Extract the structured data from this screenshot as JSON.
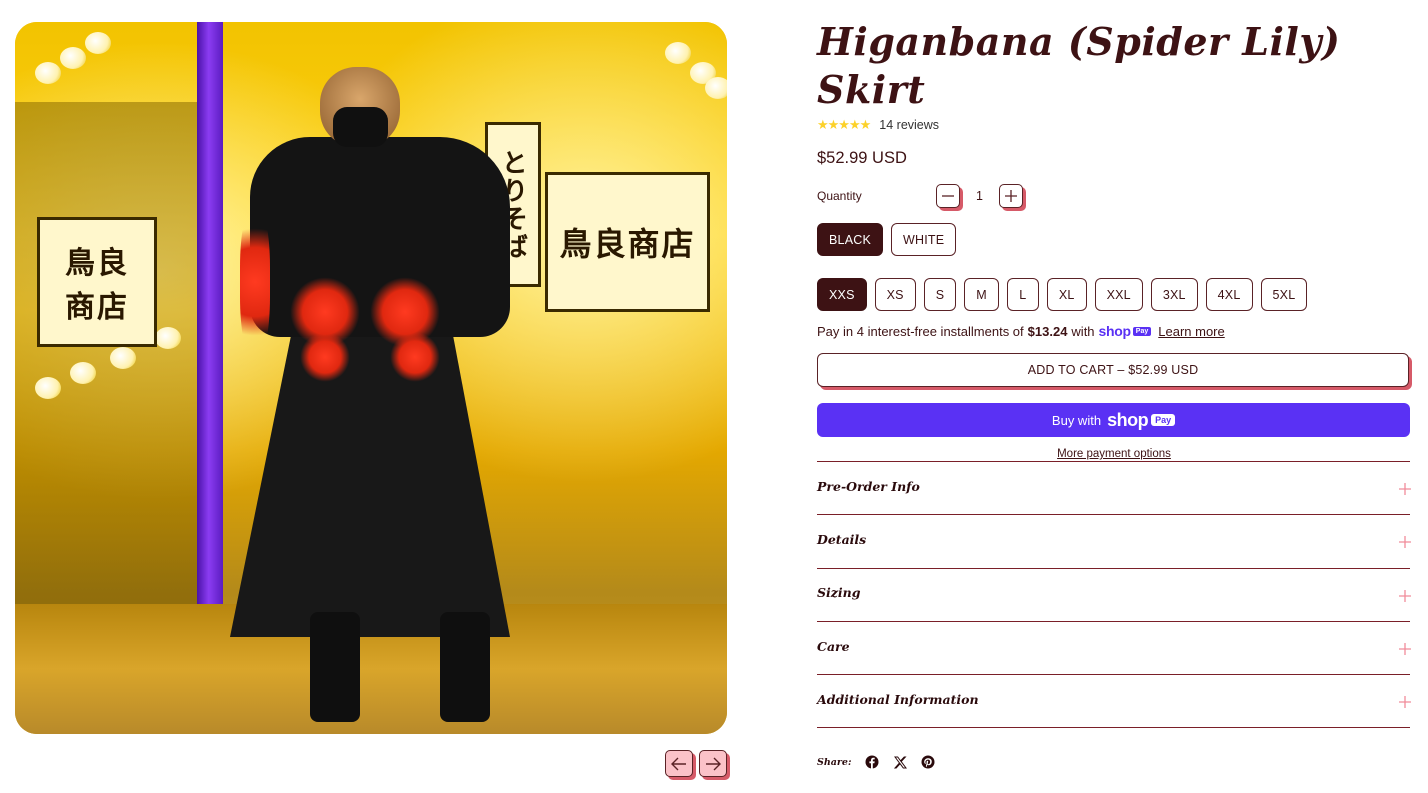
{
  "product": {
    "title": "Higanbana (Spider Lily) Skirt",
    "rating": {
      "stars": 5,
      "stars_display": "★★★★★",
      "review_count": "14 reviews"
    },
    "price": "$52.99 USD"
  },
  "quantity": {
    "label": "Quantity",
    "value": "1",
    "minus_icon": "minus-icon",
    "plus_icon": "plus-icon"
  },
  "colors": {
    "selected": "BLACK",
    "options": [
      "BLACK",
      "WHITE"
    ]
  },
  "sizes": {
    "selected": "XXS",
    "options": [
      "XXS",
      "XS",
      "S",
      "M",
      "L",
      "XL",
      "XXL",
      "3XL",
      "4XL",
      "5XL"
    ]
  },
  "installments": {
    "prefix": "Pay in 4 interest-free installments of",
    "amount": "$13.24",
    "with": "with",
    "shop_word": "shop",
    "pay_badge": "Pay",
    "learn_more": "Learn more"
  },
  "buttons": {
    "add_to_cart": "ADD TO CART – $52.99 USD",
    "buy_with": "Buy with",
    "shop_logo": "shop",
    "pay_badge": "Pay",
    "more_payment_options": "More payment options"
  },
  "accordion": [
    {
      "title": "Pre-Order Info",
      "icon": "plus-icon"
    },
    {
      "title": "Details",
      "icon": "plus-icon"
    },
    {
      "title": "Sizing",
      "icon": "plus-icon"
    },
    {
      "title": "Care",
      "icon": "plus-icon"
    },
    {
      "title": "Additional Information",
      "icon": "plus-icon"
    }
  ],
  "share": {
    "label": "Share:",
    "icons": [
      "facebook-icon",
      "x-twitter-icon",
      "pinterest-icon"
    ]
  },
  "gallery": {
    "image_alt": "Model wearing black Higanbana skirt with red spider lily embroidery on a lit street at night",
    "prev_icon": "arrow-left-icon",
    "next_icon": "arrow-right-icon"
  },
  "theme": {
    "text": "#3d1214",
    "accent_shadow": "#d65a68",
    "arrow_bg": "#fbc2c8",
    "shop_pay": "#5a31f4",
    "star": "#fcd12a",
    "divider": "#7a1f28",
    "plus": "#f08c9a"
  }
}
